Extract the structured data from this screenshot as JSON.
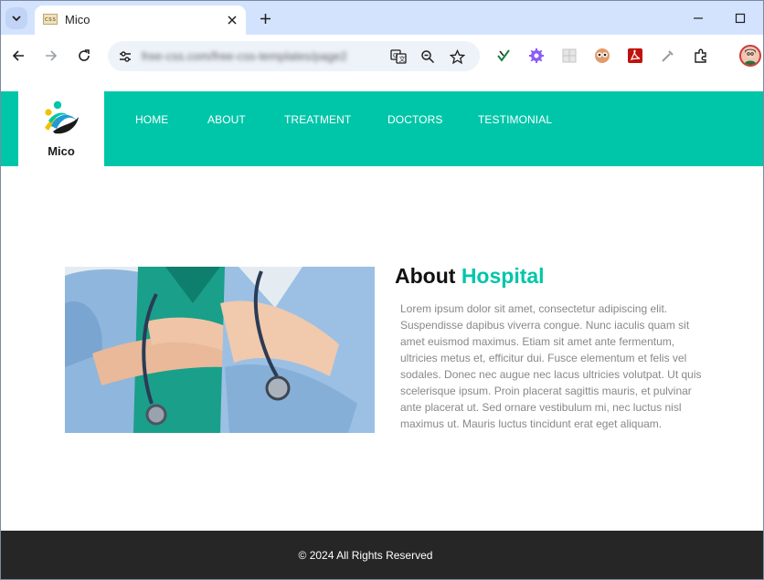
{
  "browser": {
    "tab": {
      "title": "Mico",
      "favicon_text": "css"
    },
    "url": "free-css.com/free-css-templates/page2",
    "icons": {
      "tab_search": "chevron-down-icon",
      "close": "close-icon",
      "new_tab": "plus-icon",
      "minimize": "minimize-icon",
      "maximize": "maximize-icon",
      "back": "back-arrow-icon",
      "forward": "forward-arrow-icon",
      "reload": "reload-icon",
      "site_info": "tune-icon",
      "translate": "translate-icon",
      "zoom": "zoom-icon",
      "bookmark": "star-icon",
      "extensions": "puzzle-icon"
    }
  },
  "site": {
    "brand": "Mico",
    "nav": [
      "HOME",
      "ABOUT",
      "TREATMENT",
      "DOCTORS",
      "TESTIMONIAL"
    ],
    "about": {
      "title_main": "About",
      "title_accent": "Hospital",
      "body": "Lorem ipsum dolor sit amet, consectetur adipiscing elit. Suspendisse dapibus viverra congue. Nunc iaculis quam sit amet euismod maximus. Etiam sit amet ante fermentum, ultricies metus et, efficitur dui. Fusce elementum et felis vel sodales. Donec nec augue nec lacus ultricies volutpat. Ut quis scelerisque ipsum. Proin placerat sagittis mauris, et pulvinar ante placerat ut. Sed ornare vestibulum mi, nec luctus nisl maximus ut. Mauris luctus tincidunt erat eget aliquam."
    },
    "footer": "© 2024 All Rights Reserved"
  },
  "colors": {
    "accent": "#00c6a9",
    "footer_bg": "#262626",
    "tabbar_bg": "#d3e3fd"
  }
}
